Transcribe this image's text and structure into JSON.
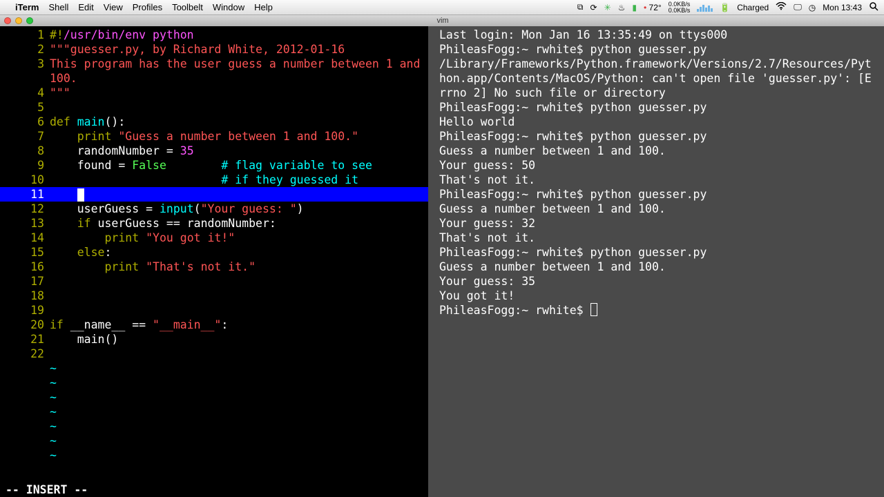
{
  "menubar": {
    "appname": "iTerm",
    "items": [
      "Shell",
      "Edit",
      "View",
      "Profiles",
      "Toolbelt",
      "Window",
      "Help"
    ],
    "temp": "72°",
    "net_up": "0.0KB/s",
    "net_down": "0.0KB/s",
    "battery": "Charged",
    "clock": "Mon 13:43"
  },
  "window": {
    "title": "vim"
  },
  "vim": {
    "status": "-- INSERT --",
    "lines": [
      {
        "n": "1",
        "seg": [
          {
            "c": "y",
            "t": "#!"
          },
          {
            "c": "m",
            "t": "/usr/bin/env python"
          }
        ]
      },
      {
        "n": "2",
        "seg": [
          {
            "c": "r",
            "t": "\"\"\"guesser.py, by Richard White, 2012-01-16"
          }
        ]
      },
      {
        "n": "3",
        "seg": [
          {
            "c": "r",
            "t": "This program has the user guess a number between 1 and 100."
          }
        ],
        "wrap": true
      },
      {
        "n": "4",
        "seg": [
          {
            "c": "r",
            "t": "\"\"\""
          }
        ]
      },
      {
        "n": "5",
        "seg": [
          {
            "c": "",
            "t": ""
          }
        ]
      },
      {
        "n": "6",
        "seg": [
          {
            "c": "y",
            "t": "def "
          },
          {
            "c": "cy",
            "t": "main"
          },
          {
            "c": "",
            "t": "():"
          }
        ]
      },
      {
        "n": "7",
        "seg": [
          {
            "c": "",
            "t": "    "
          },
          {
            "c": "y",
            "t": "print "
          },
          {
            "c": "r",
            "t": "\"Guess a number between 1 and 100.\""
          }
        ]
      },
      {
        "n": "8",
        "seg": [
          {
            "c": "",
            "t": "    randomNumber = "
          },
          {
            "c": "m",
            "t": "35"
          }
        ]
      },
      {
        "n": "9",
        "seg": [
          {
            "c": "",
            "t": "    found = "
          },
          {
            "c": "g",
            "t": "False"
          },
          {
            "c": "",
            "t": "        "
          },
          {
            "c": "cy",
            "t": "# flag variable to see"
          }
        ]
      },
      {
        "n": "10",
        "seg": [
          {
            "c": "",
            "t": "                         "
          },
          {
            "c": "cy",
            "t": "# if they guessed it"
          }
        ]
      },
      {
        "n": "11",
        "hl": true,
        "seg": [
          {
            "c": "",
            "t": "    "
          }
        ],
        "cursor": true
      },
      {
        "n": "12",
        "seg": [
          {
            "c": "",
            "t": "    userGuess = "
          },
          {
            "c": "cy",
            "t": "input"
          },
          {
            "c": "",
            "t": "("
          },
          {
            "c": "r",
            "t": "\"Your guess: \""
          },
          {
            "c": "",
            "t": ")"
          }
        ]
      },
      {
        "n": "13",
        "seg": [
          {
            "c": "",
            "t": "    "
          },
          {
            "c": "y",
            "t": "if"
          },
          {
            "c": "",
            "t": " userGuess == randomNumber:"
          }
        ]
      },
      {
        "n": "14",
        "seg": [
          {
            "c": "",
            "t": "        "
          },
          {
            "c": "y",
            "t": "print "
          },
          {
            "c": "r",
            "t": "\"You got it!\""
          }
        ]
      },
      {
        "n": "15",
        "seg": [
          {
            "c": "",
            "t": "    "
          },
          {
            "c": "y",
            "t": "else"
          },
          {
            "c": "",
            "t": ":"
          }
        ]
      },
      {
        "n": "16",
        "seg": [
          {
            "c": "",
            "t": "        "
          },
          {
            "c": "y",
            "t": "print "
          },
          {
            "c": "r",
            "t": "\"That's not it.\""
          }
        ]
      },
      {
        "n": "17",
        "seg": [
          {
            "c": "",
            "t": ""
          }
        ]
      },
      {
        "n": "18",
        "seg": [
          {
            "c": "",
            "t": ""
          }
        ]
      },
      {
        "n": "19",
        "seg": [
          {
            "c": "",
            "t": ""
          }
        ]
      },
      {
        "n": "20",
        "seg": [
          {
            "c": "y",
            "t": "if"
          },
          {
            "c": "",
            "t": " __name__ == "
          },
          {
            "c": "r",
            "t": "\"__main__\""
          },
          {
            "c": "",
            "t": ":"
          }
        ]
      },
      {
        "n": "21",
        "seg": [
          {
            "c": "",
            "t": "    main()"
          }
        ]
      },
      {
        "n": "22",
        "seg": [
          {
            "c": "",
            "t": ""
          }
        ]
      }
    ],
    "tilde": "~"
  },
  "shell": {
    "lines": [
      "Last login: Mon Jan 16 13:35:49 on ttys000",
      "PhileasFogg:~ rwhite$ python guesser.py",
      "/Library/Frameworks/Python.framework/Versions/2.7/Resources/Python.app/Contents/MacOS/Python: can't open file 'guesser.py': [Errno 2] No such file or directory",
      "PhileasFogg:~ rwhite$ python guesser.py",
      "Hello world",
      "PhileasFogg:~ rwhite$ python guesser.py",
      "Guess a number between 1 and 100.",
      "Your guess: 50",
      "That's not it.",
      "PhileasFogg:~ rwhite$ python guesser.py",
      "Guess a number between 1 and 100.",
      "Your guess: 32",
      "That's not it.",
      "PhileasFogg:~ rwhite$ python guesser.py",
      "Guess a number between 1 and 100.",
      "Your guess: 35",
      "You got it!",
      "PhileasFogg:~ rwhite$ "
    ]
  }
}
